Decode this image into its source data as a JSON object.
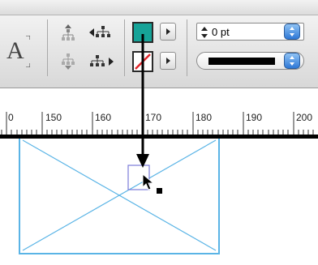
{
  "control_panel": {
    "type_sample_letter": "A",
    "stroke_weight": {
      "value": "0 pt"
    },
    "fill_color": "#16a398",
    "stroke_swatch_state": "none",
    "stroke_type_color": "#000000",
    "accent_color": "#4a90e2"
  },
  "ruler": {
    "labels": [
      "0",
      "150",
      "160",
      "170",
      "180",
      "190",
      "200"
    ]
  },
  "canvas": {
    "frame_stroke_color": "#5ab4e6",
    "selection_color": "#7b7bd9",
    "callout_arrow_color": "#000000"
  }
}
